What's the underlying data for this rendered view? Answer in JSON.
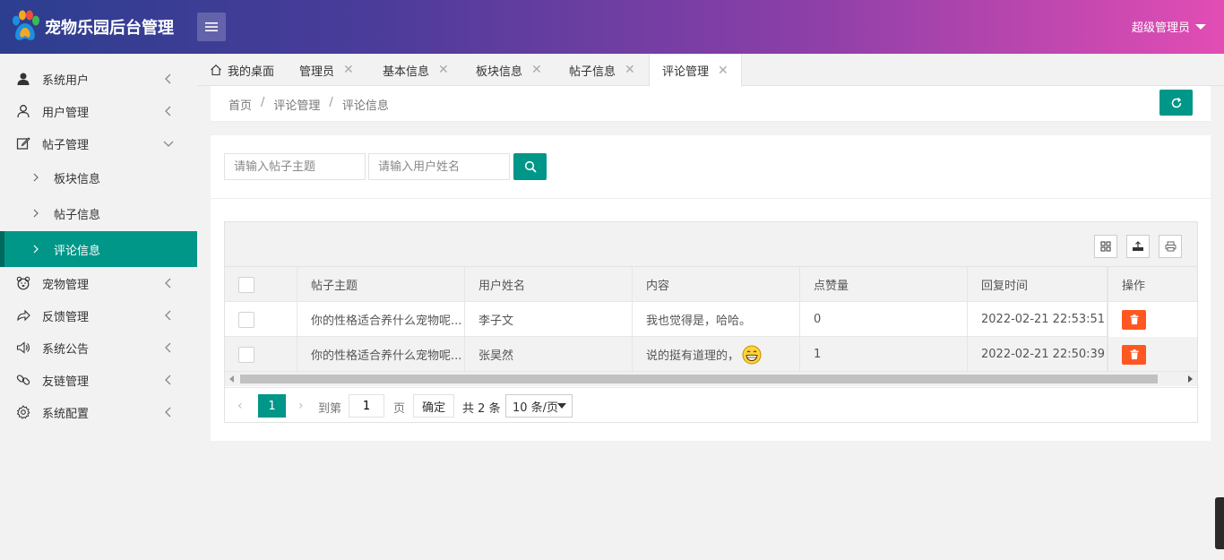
{
  "header": {
    "title": "宠物乐园后台管理",
    "user": "超级管理员",
    "logo_icon": "paw-icon",
    "menu_icon": "menu-icon"
  },
  "sidebar": {
    "items": [
      {
        "label": "系统用户",
        "icon": "user-filled-icon",
        "arrow": "chevron-left"
      },
      {
        "label": "用户管理",
        "icon": "user-icon",
        "arrow": "chevron-left"
      },
      {
        "label": "帖子管理",
        "icon": "edit-icon",
        "arrow": "chevron-down"
      },
      {
        "label": "宠物管理",
        "icon": "bear-icon",
        "arrow": "chevron-left"
      },
      {
        "label": "反馈管理",
        "icon": "share-icon",
        "arrow": "chevron-left"
      },
      {
        "label": "系统公告",
        "icon": "speaker-icon",
        "arrow": "chevron-left"
      },
      {
        "label": "友链管理",
        "icon": "link-icon",
        "arrow": "chevron-left"
      },
      {
        "label": "系统配置",
        "icon": "gear-icon",
        "arrow": "chevron-left"
      }
    ],
    "sub_items": [
      {
        "label": "板块信息"
      },
      {
        "label": "帖子信息"
      },
      {
        "label": "评论信息",
        "active": true
      }
    ]
  },
  "tabs": [
    {
      "label": "我的桌面",
      "icon": "home-icon"
    },
    {
      "label": "管理员"
    },
    {
      "label": "基本信息"
    },
    {
      "label": "板块信息"
    },
    {
      "label": "帖子信息"
    },
    {
      "label": "评论管理",
      "active": true
    }
  ],
  "breadcrumb": [
    "首页",
    "评论管理",
    "评论信息"
  ],
  "search": {
    "topic_placeholder": "请输入帖子主题",
    "user_placeholder": "请输入用户姓名"
  },
  "table": {
    "columns": [
      "帖子主题",
      "用户姓名",
      "内容",
      "点赞量",
      "回复时间",
      "操作"
    ],
    "rows": [
      {
        "topic": "你的性格适合养什么宠物呢...",
        "user": "李子文",
        "content": "我也觉得是，哈哈。",
        "likes": "0",
        "time": "2022-02-21 22:53:51",
        "emoji": ""
      },
      {
        "topic": "你的性格适合养什么宠物呢...",
        "user": "张昊然",
        "content": "说的挺有道理的，",
        "likes": "1",
        "time": "2022-02-21 22:50:39",
        "emoji": "grin-emoji"
      }
    ]
  },
  "pager": {
    "current": "1",
    "goto_prefix": "到第",
    "goto_value": "1",
    "goto_suffix": "页",
    "ok": "确定",
    "total": "共 2 条",
    "page_size": "10 条/页"
  },
  "colors": {
    "accent": "#009688",
    "danger": "#ff5722"
  }
}
